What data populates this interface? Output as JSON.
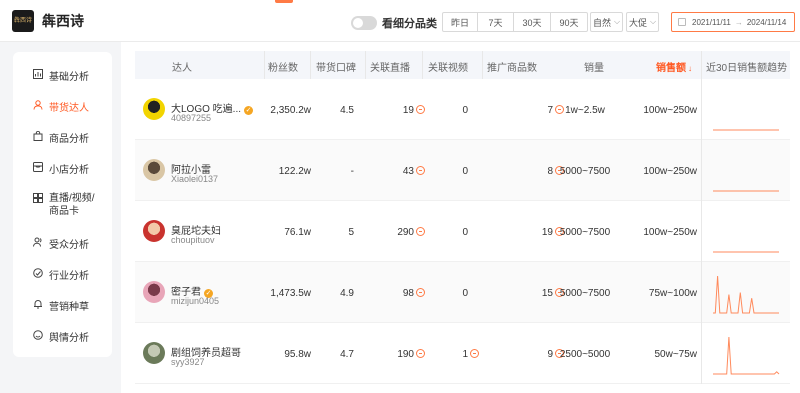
{
  "brand": {
    "name": "犇西诗",
    "logo_text": "犇西诗"
  },
  "toggle": {
    "label": "看细分品类",
    "on": false
  },
  "period_tabs": [
    "昨日",
    "7天",
    "30天",
    "90天"
  ],
  "filters": {
    "nature": "自然",
    "size": "大促"
  },
  "date_range": {
    "start": "2021/11/11",
    "end": "2024/11/14",
    "separator": "→"
  },
  "sidebar": {
    "items": [
      {
        "label": "基础分析",
        "icon": "chart-icon",
        "active": false
      },
      {
        "label": "带货达人",
        "icon": "person-icon",
        "active": true
      },
      {
        "label": "商品分析",
        "icon": "bag-icon",
        "active": false
      },
      {
        "label": "小店分析",
        "icon": "store-icon",
        "active": false
      },
      {
        "label": "直播/视频/商品卡",
        "icon": "grid-icon",
        "active": false
      },
      {
        "label": "受众分析",
        "icon": "audience-icon",
        "active": false
      },
      {
        "label": "行业分析",
        "icon": "gauge-icon",
        "active": false
      },
      {
        "label": "营销种草",
        "icon": "bell-icon",
        "active": false
      },
      {
        "label": "舆情分析",
        "icon": "sentiment-icon",
        "active": false
      }
    ]
  },
  "table": {
    "columns": {
      "talent": "达人",
      "fans": "粉丝数",
      "reputation": "带货口碑",
      "live": "关联直播",
      "video": "关联视频",
      "products": "推广商品数",
      "volume": "销量",
      "gmv": "销售额",
      "trend": "近30日销售额趋势"
    },
    "sort": {
      "column": "gmv",
      "direction": "desc",
      "icon": "sort-down-icon"
    },
    "accent": "#ff5a24",
    "rows": [
      {
        "name": "大LOGO 吃遍...",
        "handle": "40897255",
        "verified": true,
        "fans": "2,350.2w",
        "reputation": "4.5",
        "live": "19",
        "live_more": true,
        "video": "0",
        "video_more": false,
        "products": "7",
        "volume": "1w~2.5w",
        "gmv": "100w~250w",
        "trend": [
          0,
          0,
          0,
          0,
          0,
          0,
          0,
          0,
          0,
          0,
          0,
          0,
          0,
          0,
          0,
          0,
          0,
          0,
          0,
          0,
          0,
          0,
          0,
          0,
          0,
          0,
          0,
          0,
          0,
          0
        ]
      },
      {
        "name": "阿拉小雷",
        "handle": "Xiaolei0137",
        "verified": false,
        "fans": "122.2w",
        "reputation": "-",
        "live": "43",
        "live_more": true,
        "video": "0",
        "video_more": false,
        "products": "8",
        "volume": "5000~7500",
        "gmv": "100w~250w",
        "trend": [
          0,
          0,
          0,
          0,
          0,
          0,
          0,
          0,
          0,
          0,
          0,
          0,
          0,
          0,
          0,
          0,
          0,
          0,
          0,
          0,
          0,
          0,
          0,
          0,
          0,
          0,
          0,
          0,
          0,
          0
        ]
      },
      {
        "name": "臭屁坨夫妇",
        "handle": "choupituov",
        "verified": false,
        "fans": "76.1w",
        "reputation": "5",
        "live": "290",
        "live_more": true,
        "video": "0",
        "video_more": false,
        "products": "19",
        "volume": "5000~7500",
        "gmv": "100w~250w",
        "trend": [
          0,
          0,
          0,
          0,
          0,
          0,
          0,
          0,
          0,
          0,
          0,
          0,
          0,
          0,
          0,
          0,
          0,
          0,
          0,
          0,
          0,
          0,
          0,
          0,
          0,
          0,
          0,
          0,
          0,
          0
        ]
      },
      {
        "name": "密子君",
        "handle": "mizijun0405",
        "verified": true,
        "fans": "1,473.5w",
        "reputation": "4.9",
        "live": "98",
        "live_more": true,
        "video": "0",
        "video_more": false,
        "products": "15",
        "volume": "5000~7500",
        "gmv": "75w~100w",
        "trend": [
          0,
          0,
          100,
          0,
          0,
          0,
          0,
          50,
          0,
          0,
          0,
          0,
          55,
          0,
          0,
          0,
          0,
          40,
          0,
          0,
          0,
          0,
          0,
          0,
          0,
          0,
          0,
          0,
          0,
          0
        ]
      },
      {
        "name": "剧组饲养员超哥",
        "handle": "syy3927",
        "verified": false,
        "fans": "95.8w",
        "reputation": "4.7",
        "live": "190",
        "live_more": true,
        "video": "1",
        "video_more": true,
        "products": "9",
        "volume": "2500~5000",
        "gmv": "50w~75w",
        "trend": [
          0,
          0,
          0,
          0,
          0,
          0,
          0,
          100,
          0,
          0,
          0,
          0,
          0,
          0,
          0,
          0,
          0,
          0,
          0,
          0,
          0,
          0,
          0,
          0,
          0,
          0,
          0,
          0,
          6,
          0
        ]
      }
    ]
  }
}
